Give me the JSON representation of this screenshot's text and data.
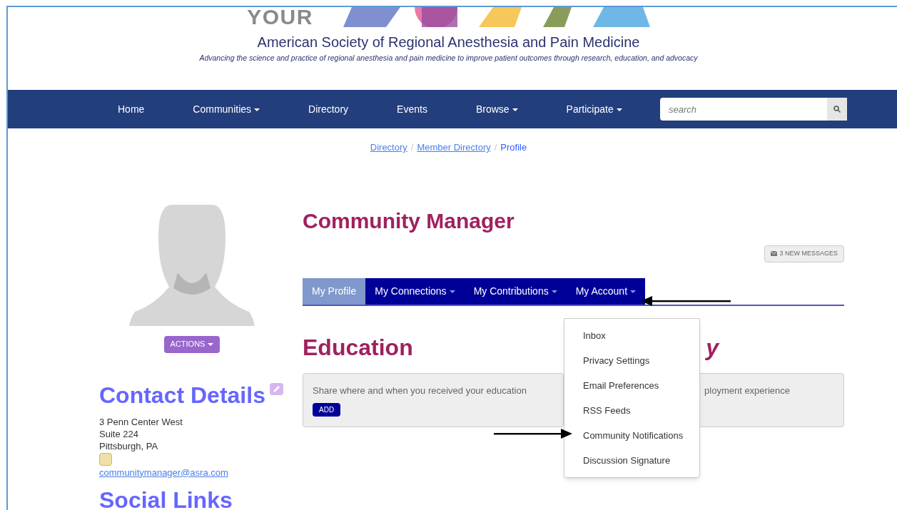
{
  "header": {
    "logo_word": "YOUR",
    "org_name": "American Society of Regional Anesthesia and Pain Medicine",
    "tagline": "Advancing the science and practice of regional anesthesia and pain medicine to improve patient outcomes through research, education, and advocacy"
  },
  "nav": {
    "items": [
      {
        "label": "Home",
        "dropdown": false
      },
      {
        "label": "Communities",
        "dropdown": true
      },
      {
        "label": "Directory",
        "dropdown": false
      },
      {
        "label": "Events",
        "dropdown": false
      },
      {
        "label": "Browse",
        "dropdown": true
      },
      {
        "label": "Participate",
        "dropdown": true
      }
    ],
    "search": {
      "placeholder": "search"
    }
  },
  "breadcrumb": [
    {
      "label": "Directory",
      "link": true
    },
    {
      "separator": "/",
      "label": "Member Directory",
      "link": true
    },
    {
      "separator": "/",
      "label": "Profile",
      "link": false
    }
  ],
  "sidebar": {
    "actions_button": "ACTIONS",
    "contact_heading": "Contact Details",
    "address": [
      "3 Penn Center West",
      "Suite 224",
      "Pittsburgh, PA"
    ],
    "email": "communitymanager@asra.com",
    "social_heading": "Social Links"
  },
  "profile": {
    "name": "Community Manager",
    "messages_button": "3 NEW MESSAGES",
    "tabs": [
      {
        "label": "My Profile",
        "selected": true,
        "dropdown": false
      },
      {
        "label": "My Connections",
        "selected": false,
        "dropdown": true
      },
      {
        "label": "My Contributions",
        "selected": false,
        "dropdown": true
      },
      {
        "label": "My Account",
        "selected": false,
        "dropdown": true
      }
    ],
    "sections": [
      {
        "heading": "Education",
        "prompt": "Share where and when you received your education",
        "add_button": "ADD"
      },
      {
        "heading": "y",
        "prompt": "ployment experience"
      }
    ],
    "account_menu": [
      {
        "label": "Inbox"
      },
      {
        "label": "Privacy Settings"
      },
      {
        "label": "Email Preferences"
      },
      {
        "label": "RSS Feeds"
      },
      {
        "label": "Community Notifications"
      },
      {
        "label": "Discussion Signature"
      }
    ]
  }
}
